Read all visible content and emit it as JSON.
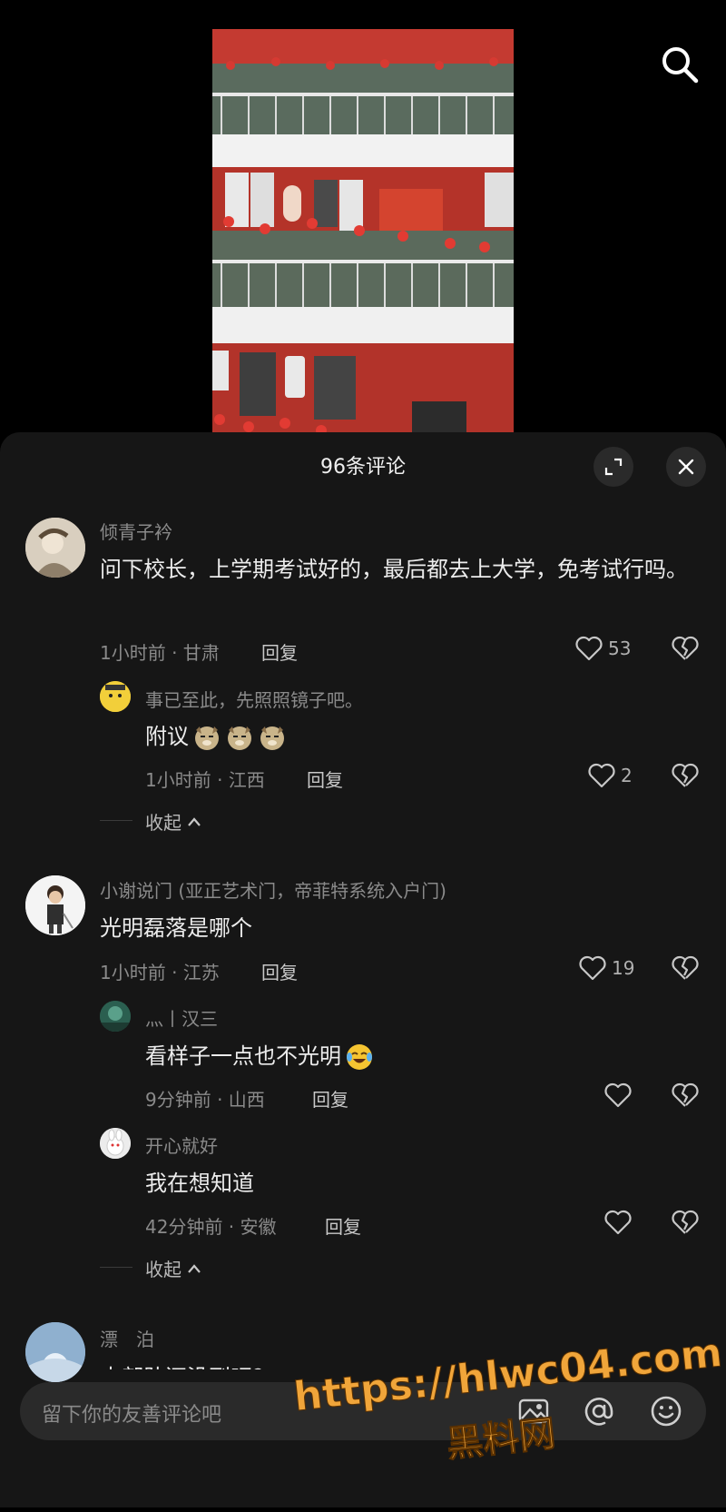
{
  "sheet": {
    "title": "96条评论"
  },
  "comments": [
    {
      "user": "倾青子衿",
      "text": "问下校长，上学期考试好的，最后都去上大学，免考试行吗。",
      "time_loc": "1小时前 · 甘肃",
      "reply": "回复",
      "likes": "53",
      "replies": [
        {
          "user": "事已至此，先照照镜子吧。",
          "text": "附议",
          "time_loc": "1小时前 · 江西",
          "reply": "回复",
          "likes": "2"
        }
      ],
      "collapse": "收起"
    },
    {
      "user": "小谢说门 (亚正艺术门，帝菲特系统入户门)",
      "text": "光明磊落是哪个",
      "time_loc": "1小时前 · 江苏",
      "reply": "回复",
      "likes": "19",
      "replies": [
        {
          "user": "灬丨汉三",
          "text": "看样子一点也不光明",
          "time_loc": "9分钟前 · 山西",
          "reply": "回复"
        },
        {
          "user": "开心就好",
          "text": "我在想知道",
          "time_loc": "42分钟前 · 安徽",
          "reply": "回复"
        }
      ],
      "collapse": "收起"
    },
    {
      "user": "漂　泊",
      "text": "大部队还没到吧？"
    }
  ],
  "input": {
    "placeholder": "留下你的友善评论吧"
  },
  "watermark": {
    "url": "https://hlwc04.com",
    "name": "黑料网"
  },
  "icons": {
    "search": "search-icon",
    "expand": "expand-icon",
    "close": "close-icon",
    "heart": "heart-icon",
    "dislike": "broken-heart-icon",
    "image": "image-icon",
    "mention": "at-icon",
    "emoji": "smiley-icon"
  }
}
